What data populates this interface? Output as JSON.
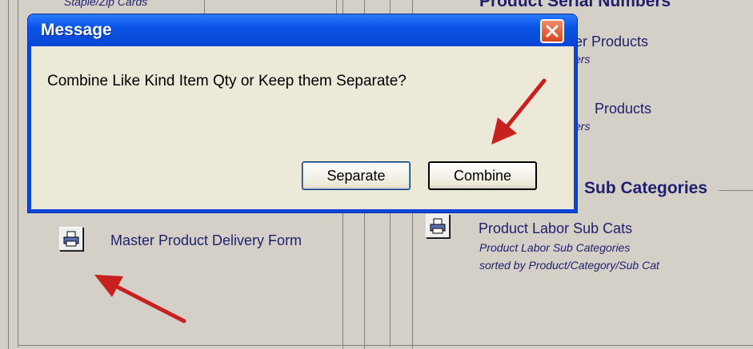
{
  "background": {
    "top_left_text": "Staple/Zip Cards",
    "top_right_header": "Product Serial Numbers",
    "items_right": [
      {
        "label": "er Products",
        "sub": "ers"
      },
      {
        "label": "Products",
        "sub": "ers"
      }
    ],
    "section_header": "Sub Categories",
    "left_report": {
      "label": "Master Product Delivery Form"
    },
    "right_report": {
      "label": "Product Labor Sub Cats",
      "sub1": "Product Labor Sub Categories",
      "sub2": "sorted by Product/Category/Sub Cat"
    }
  },
  "dialog": {
    "title": "Message",
    "message": "Combine Like Kind Item Qty or Keep them Separate?",
    "buttons": {
      "separate": "Separate",
      "combine": "Combine"
    }
  },
  "colors": {
    "arrow": "#c8201e",
    "link_text": "#1f1f6e",
    "titlebar": "#0b54e6"
  }
}
